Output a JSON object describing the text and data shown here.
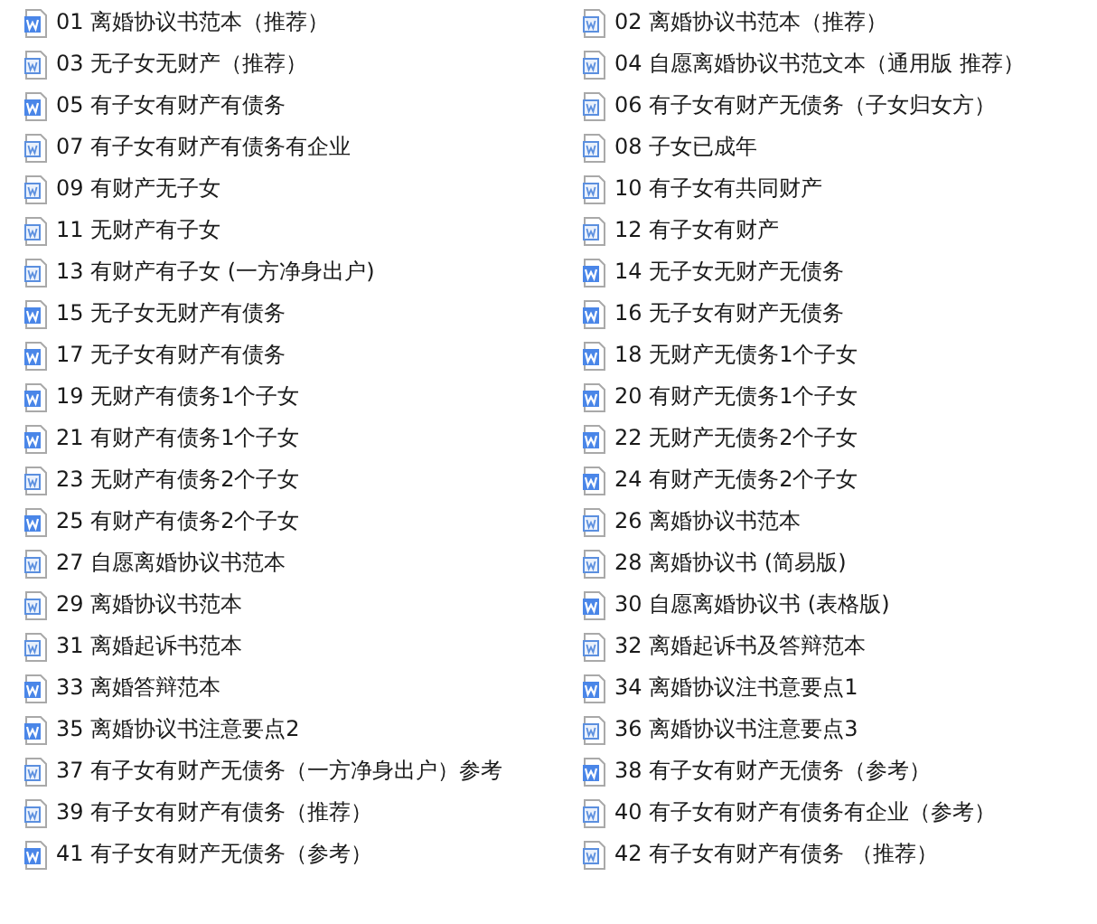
{
  "files": [
    {
      "name": "01 离婚协议书范本（推荐）",
      "kind": "docx"
    },
    {
      "name": "02 离婚协议书范本（推荐）",
      "kind": "doc"
    },
    {
      "name": "03 无子女无财产（推荐）",
      "kind": "doc"
    },
    {
      "name": "04 自愿离婚协议书范文本（通用版 推荐）",
      "kind": "doc"
    },
    {
      "name": "05 有子女有财产有债务",
      "kind": "docx"
    },
    {
      "name": "06 有子女有财产无债务（子女归女方）",
      "kind": "doc"
    },
    {
      "name": "07 有子女有财产有债务有企业",
      "kind": "doc"
    },
    {
      "name": "08 子女已成年",
      "kind": "doc"
    },
    {
      "name": "09 有财产无子女",
      "kind": "doc"
    },
    {
      "name": "10 有子女有共同财产",
      "kind": "doc"
    },
    {
      "name": "11 无财产有子女",
      "kind": "doc"
    },
    {
      "name": "12 有子女有财产",
      "kind": "doc"
    },
    {
      "name": "13 有财产有子女 (一方净身出户)",
      "kind": "doc"
    },
    {
      "name": "14 无子女无财产无债务",
      "kind": "docx"
    },
    {
      "name": "15 无子女无财产有债务",
      "kind": "docx"
    },
    {
      "name": "16 无子女有财产无债务",
      "kind": "docx"
    },
    {
      "name": "17 无子女有财产有债务",
      "kind": "docx"
    },
    {
      "name": "18 无财产无债务1个子女",
      "kind": "docx"
    },
    {
      "name": "19 无财产有债务1个子女",
      "kind": "docx"
    },
    {
      "name": "20 有财产无债务1个子女",
      "kind": "docx"
    },
    {
      "name": "21 有财产有债务1个子女",
      "kind": "docx"
    },
    {
      "name": "22 无财产无债务2个子女",
      "kind": "docx"
    },
    {
      "name": "23 无财产有债务2个子女",
      "kind": "doc"
    },
    {
      "name": "24 有财产无债务2个子女",
      "kind": "docx"
    },
    {
      "name": "25 有财产有债务2个子女",
      "kind": "docx"
    },
    {
      "name": "26 离婚协议书范本",
      "kind": "doc"
    },
    {
      "name": "27 自愿离婚协议书范本",
      "kind": "doc"
    },
    {
      "name": "28 离婚协议书 (简易版)",
      "kind": "doc"
    },
    {
      "name": "29 离婚协议书范本",
      "kind": "doc"
    },
    {
      "name": "30 自愿离婚协议书 (表格版)",
      "kind": "docx"
    },
    {
      "name": "31 离婚起诉书范本",
      "kind": "doc"
    },
    {
      "name": "32 离婚起诉书及答辩范本",
      "kind": "doc"
    },
    {
      "name": "33 离婚答辩范本",
      "kind": "docx"
    },
    {
      "name": "34 离婚协议注书意要点1",
      "kind": "docx"
    },
    {
      "name": "35 离婚协议书注意要点2",
      "kind": "docx"
    },
    {
      "name": "36 离婚协议书注意要点3",
      "kind": "doc"
    },
    {
      "name": "37 有子女有财产无债务（一方净身出户）参考",
      "kind": "doc"
    },
    {
      "name": "38 有子女有财产无债务（参考）",
      "kind": "docx"
    },
    {
      "name": "39 有子女有财产有债务（推荐）",
      "kind": "doc"
    },
    {
      "name": "40 有子女有财产有债务有企业（参考）",
      "kind": "doc"
    },
    {
      "name": "41 有子女有财产无债务（参考）",
      "kind": "docx"
    },
    {
      "name": "42 有子女有财产有债务 （推荐）",
      "kind": "doc"
    }
  ]
}
